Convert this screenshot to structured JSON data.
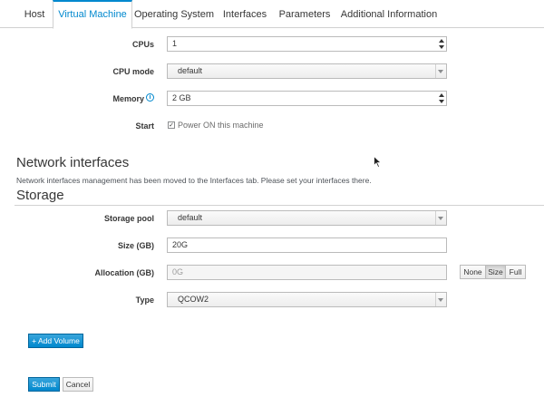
{
  "tabs": [
    {
      "label": "Host"
    },
    {
      "label": "Virtual Machine"
    },
    {
      "label": "Operating System"
    },
    {
      "label": "Interfaces"
    },
    {
      "label": "Parameters"
    },
    {
      "label": "Additional Information"
    }
  ],
  "vm": {
    "cpus_label": "CPUs",
    "cpus_value": "1",
    "cpu_mode_label": "CPU mode",
    "cpu_mode_value": "default",
    "memory_label": "Memory",
    "memory_value": "2 GB",
    "start_label": "Start",
    "start_checkbox_label": "Power ON this machine",
    "start_checked": true
  },
  "network": {
    "title": "Network interfaces",
    "note": "Network interfaces management has been moved to the Interfaces tab. Please set your interfaces there."
  },
  "storage": {
    "title": "Storage",
    "pool_label": "Storage pool",
    "pool_value": "default",
    "size_label": "Size (GB)",
    "size_value": "20G",
    "allocation_label": "Allocation (GB)",
    "allocation_value": "0G",
    "allocation_options": [
      "None",
      "Size",
      "Full"
    ],
    "allocation_selected": "Size",
    "type_label": "Type",
    "type_value": "QCOW2"
  },
  "actions": {
    "add_volume": "+ Add Volume",
    "submit": "Submit",
    "cancel": "Cancel"
  },
  "colors": {
    "accent": "#0088ce",
    "border": "#bbbbbb"
  },
  "icons": {
    "memory_info": "info-icon",
    "start_check": "check-icon",
    "cursor": "mouse-pointer-icon"
  }
}
